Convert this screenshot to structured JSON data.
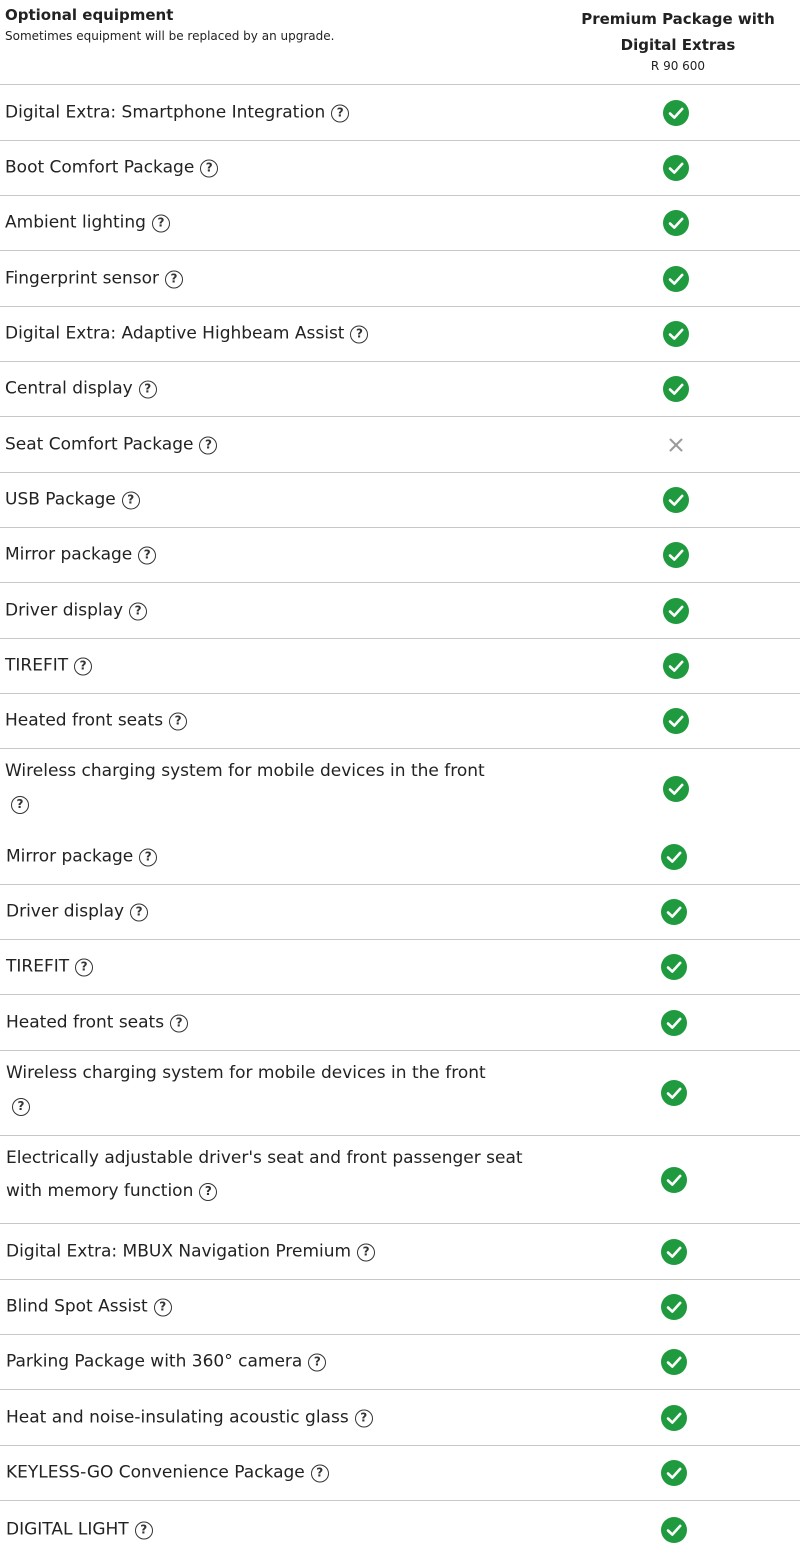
{
  "header": {
    "title": "Optional equipment",
    "subtitle": "Sometimes equipment will be replaced by an upgrade.",
    "package_name_line1": "Premium Package with",
    "package_name_line2": "Digital Extras",
    "package_price": "R 90 600"
  },
  "colors": {
    "check": "#1f9a3e",
    "cross": "#9a9a9a",
    "divider": "#c8c8c8"
  },
  "icons": {
    "help": "?",
    "included": "check-circle-icon",
    "not_included": "cross-icon"
  },
  "rows": [
    {
      "label": "Digital Extra: Smartphone Integration",
      "included": true
    },
    {
      "label": "Boot Comfort Package",
      "included": true
    },
    {
      "label": "Ambient lighting",
      "included": true
    },
    {
      "label": "Fingerprint sensor",
      "included": true
    },
    {
      "label": "Digital Extra: Adaptive Highbeam Assist",
      "included": true
    },
    {
      "label": "Central display",
      "included": true
    },
    {
      "label": "Seat Comfort Package",
      "included": false
    },
    {
      "label": "USB Package",
      "included": true
    },
    {
      "label": "Mirror package",
      "included": true
    },
    {
      "label": "Driver display",
      "included": true
    },
    {
      "label": "TIREFIT",
      "included": true
    },
    {
      "label": "Heated front seats",
      "included": true
    },
    {
      "label": "Wireless charging system for mobile devices in the front",
      "included": true
    },
    {
      "label": "Mirror package",
      "included": true
    },
    {
      "label": "Driver display",
      "included": true
    },
    {
      "label": "TIREFIT",
      "included": true
    },
    {
      "label": "Heated front seats",
      "included": true
    },
    {
      "label": "Wireless charging system for mobile devices in the front",
      "included": true
    },
    {
      "label": "Electrically adjustable driver's seat and front passenger seat with memory function",
      "included": true
    },
    {
      "label": "Digital Extra: MBUX Navigation Premium",
      "included": true
    },
    {
      "label": "Blind Spot Assist",
      "included": true
    },
    {
      "label": "Parking Package with 360° camera",
      "included": true
    },
    {
      "label": "Heat and noise-insulating acoustic glass",
      "included": true
    },
    {
      "label": "KEYLESS-GO Convenience Package",
      "included": true
    },
    {
      "label": "DIGITAL LIGHT",
      "included": true
    }
  ]
}
